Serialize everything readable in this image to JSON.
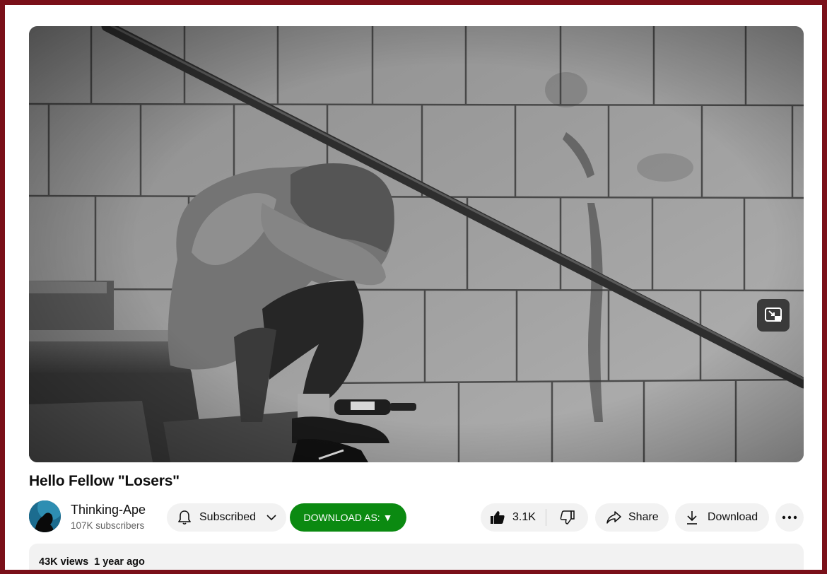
{
  "video": {
    "title": "Hello Fellow \"Losers\""
  },
  "channel": {
    "name": "Thinking-Ape",
    "subscribers": "107K subscribers"
  },
  "actions": {
    "subscribe_label": "Subscribed",
    "download_as_label": "DOWNLOAD AS: ▼",
    "like_count": "3.1K",
    "share_label": "Share",
    "download_label": "Download"
  },
  "description": {
    "views": "43K views",
    "age": "1 year ago"
  },
  "icons": {
    "miniplayer": "miniplayer-icon",
    "bell": "bell-icon",
    "chevron": "chevron-down-icon",
    "like": "thumbs-up-icon",
    "dislike": "thumbs-down-icon",
    "share": "share-arrow-icon",
    "download": "download-icon",
    "more": "more-horizontal-icon"
  },
  "colors": {
    "border": "#7a1019",
    "download_as_button": "#0b8a11",
    "pill_background": "#f2f2f2"
  }
}
